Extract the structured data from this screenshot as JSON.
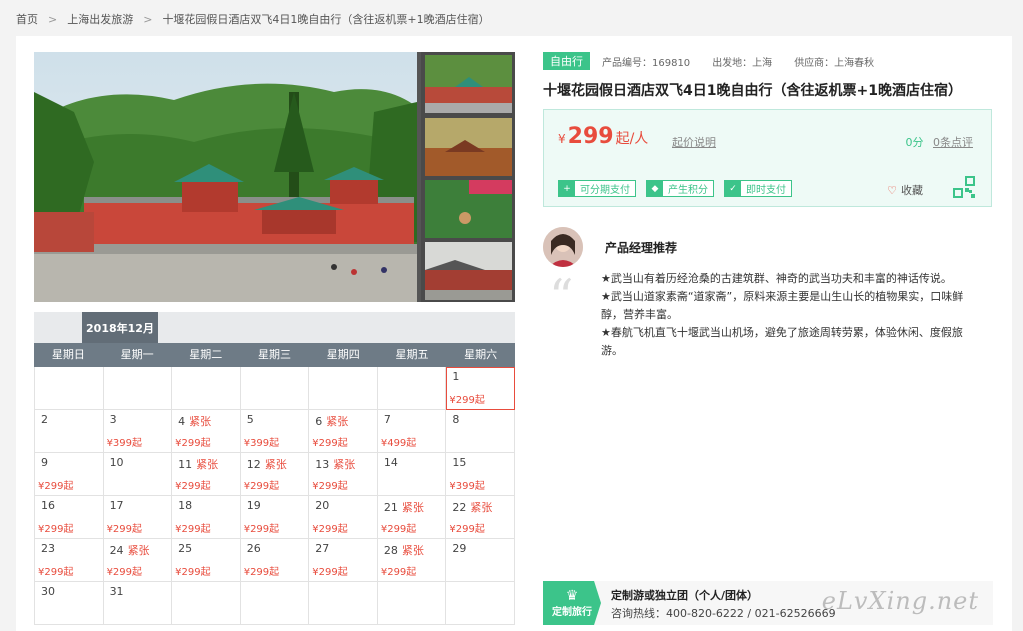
{
  "breadcrumb": {
    "items": [
      "首页",
      "上海出发旅游",
      "十堰花园假日酒店双飞4日1晚自由行（含往返机票+1晚酒店住宿）"
    ],
    "separator": ">"
  },
  "product": {
    "type": "自由行",
    "code": "产品编号：169810",
    "departure": "出发地：上海",
    "supplier": "供应商：上海春秋",
    "title": "十堰花园假日酒店双飞4日1晚自由行（含往返机票+1晚酒店住宿）"
  },
  "price": {
    "currency": "¥",
    "value": "299",
    "unit": "起/人",
    "explain_link": "起价说明",
    "score": "0分",
    "reviews": "0条点评"
  },
  "features": [
    {
      "icon": "installment-icon",
      "label": "可分期支付"
    },
    {
      "icon": "diamond-icon",
      "label": "产生积分"
    },
    {
      "icon": "check-icon",
      "label": "即时支付"
    }
  ],
  "favorite": "收藏",
  "manager": {
    "title": "产品经理推荐",
    "lines": [
      "★武当山有着历经沧桑的古建筑群、神奇的武当功夫和丰富的神话传说。",
      "★武当山道家素斋“道家斋”，原料来源主要是山生山长的植物果实，口味鲜醇，营养丰富。",
      "★春航飞机直飞十堰武当山机场，避免了旅途周转劳累，体验休闲、度假旅游。"
    ]
  },
  "calendar": {
    "month": "2018年12月",
    "weekdays": [
      "星期日",
      "星期一",
      "星期二",
      "星期三",
      "星期四",
      "星期五",
      "星期六"
    ],
    "cells": [
      {
        "d": "",
        "t": "",
        "p": ""
      },
      {
        "d": "",
        "t": "",
        "p": ""
      },
      {
        "d": "",
        "t": "",
        "p": ""
      },
      {
        "d": "",
        "t": "",
        "p": ""
      },
      {
        "d": "",
        "t": "",
        "p": ""
      },
      {
        "d": "",
        "t": "",
        "p": ""
      },
      {
        "d": "1",
        "t": "",
        "p": "¥299起",
        "sel": true
      },
      {
        "d": "2",
        "t": "",
        "p": ""
      },
      {
        "d": "3",
        "t": "",
        "p": "¥399起"
      },
      {
        "d": "4",
        "t": "紧张",
        "p": "¥299起"
      },
      {
        "d": "5",
        "t": "",
        "p": "¥399起"
      },
      {
        "d": "6",
        "t": "紧张",
        "p": "¥299起"
      },
      {
        "d": "7",
        "t": "",
        "p": "¥499起"
      },
      {
        "d": "8",
        "t": "",
        "p": ""
      },
      {
        "d": "9",
        "t": "",
        "p": "¥299起"
      },
      {
        "d": "10",
        "t": "",
        "p": ""
      },
      {
        "d": "11",
        "t": "紧张",
        "p": "¥299起"
      },
      {
        "d": "12",
        "t": "紧张",
        "p": "¥299起"
      },
      {
        "d": "13",
        "t": "紧张",
        "p": "¥299起"
      },
      {
        "d": "14",
        "t": "",
        "p": ""
      },
      {
        "d": "15",
        "t": "",
        "p": "¥399起"
      },
      {
        "d": "16",
        "t": "",
        "p": "¥299起"
      },
      {
        "d": "17",
        "t": "",
        "p": "¥299起"
      },
      {
        "d": "18",
        "t": "",
        "p": "¥299起"
      },
      {
        "d": "19",
        "t": "",
        "p": "¥299起"
      },
      {
        "d": "20",
        "t": "",
        "p": "¥299起"
      },
      {
        "d": "21",
        "t": "紧张",
        "p": "¥299起"
      },
      {
        "d": "22",
        "t": "紧张",
        "p": "¥299起"
      },
      {
        "d": "23",
        "t": "",
        "p": "¥299起"
      },
      {
        "d": "24",
        "t": "紧张",
        "p": "¥299起"
      },
      {
        "d": "25",
        "t": "",
        "p": "¥299起"
      },
      {
        "d": "26",
        "t": "",
        "p": "¥299起"
      },
      {
        "d": "27",
        "t": "",
        "p": "¥299起"
      },
      {
        "d": "28",
        "t": "紧张",
        "p": "¥299起"
      },
      {
        "d": "29",
        "t": "",
        "p": ""
      },
      {
        "d": "30",
        "t": "",
        "p": ""
      },
      {
        "d": "31",
        "t": "",
        "p": ""
      },
      {
        "d": "",
        "t": "",
        "p": ""
      },
      {
        "d": "",
        "t": "",
        "p": ""
      },
      {
        "d": "",
        "t": "",
        "p": ""
      },
      {
        "d": "",
        "t": "",
        "p": ""
      },
      {
        "d": "",
        "t": "",
        "p": ""
      }
    ]
  },
  "custom": {
    "logo": "定制旅行",
    "title": "定制游或独立团（个人/团体）",
    "hotline": "咨询热线：400-820-6222 / 021-62526669"
  },
  "watermark": "eLvXing.net",
  "colors": {
    "accent": "#3cc48a",
    "price": "#e84c3d",
    "calendar_header": "#6e7b86"
  }
}
